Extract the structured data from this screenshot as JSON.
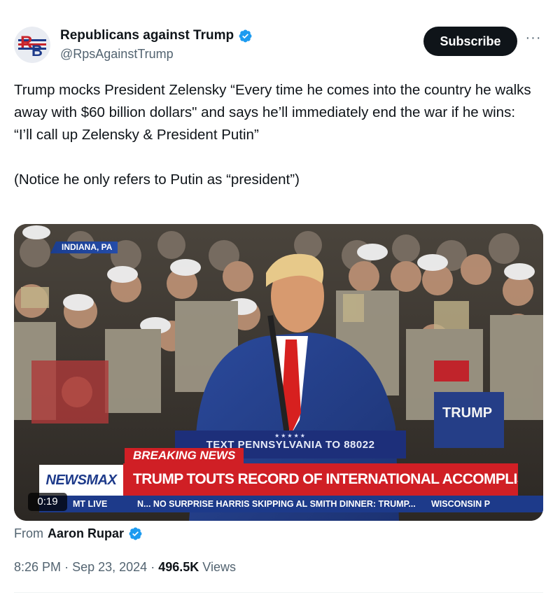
{
  "author": {
    "display_name": "Republicans against Trump",
    "handle": "@RpsAgainstTrump",
    "avatar_letters": "RB"
  },
  "actions": {
    "subscribe_label": "Subscribe",
    "more_label": "···"
  },
  "tweet": {
    "lines": [
      "Trump mocks President Zelensky “Every time he comes into the country he walks away with $60 billion dollars\" and says he’ll immediately end the war if he wins:",
      "“I’ll call up Zelensky & President Putin”",
      "(Notice he only refers to Putin as “president”)"
    ]
  },
  "video": {
    "location": "INDIANA, PA",
    "podium_stars": "★★★★★",
    "podium_text": "TEXT PENNSYLVANIA TO 88022",
    "breaking_label": "BREAKING NEWS",
    "network": "NEWSMAX",
    "headline": "TRUMP TOUTS RECORD OF INTERNATIONAL ACCOMPLISHMENTS",
    "ticker_left": "MT  LIVE",
    "ticker_1": "N...   NO SURPRISE HARRIS SKIPPING AL SMITH DINNER: TRUMP...",
    "ticker_2": "WISCONSIN P",
    "timer": "0:19"
  },
  "footer": {
    "from_label": "From",
    "from_name": "Aaron Rupar",
    "time": "8:26 PM",
    "date": "Sep 23, 2024",
    "views_count": "496.5K",
    "views_label": "Views",
    "separator": "·"
  },
  "colors": {
    "verified": "#1d9bf0",
    "breaking_red": "#d01f25",
    "newsmax_blue": "#1d3a8a"
  }
}
